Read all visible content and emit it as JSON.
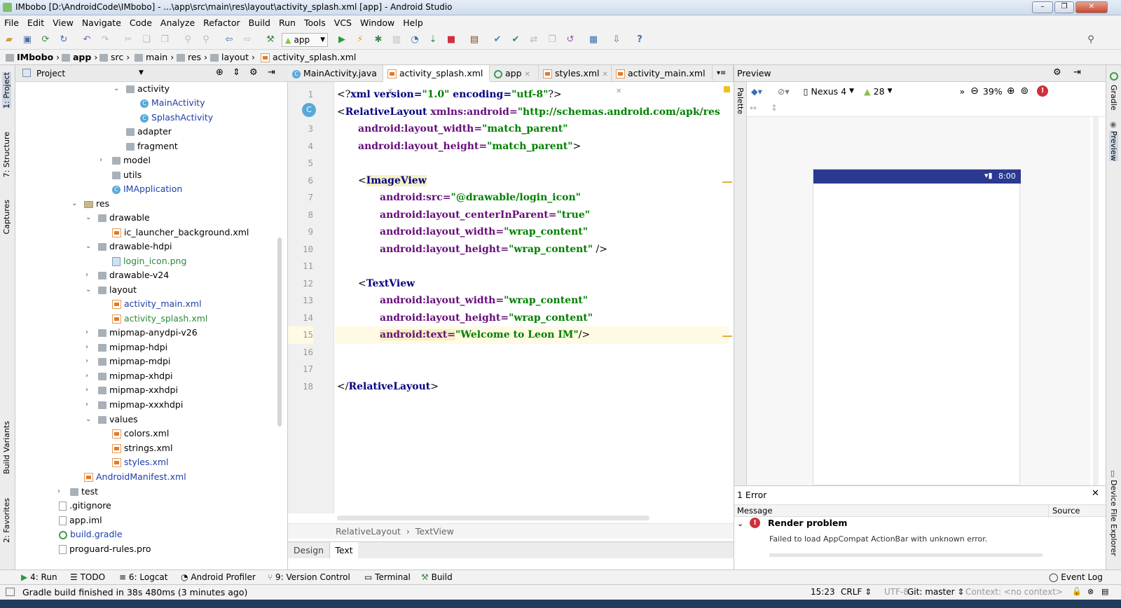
{
  "window": {
    "title": "IMbobo [D:\\AndroidCode\\IMbobo] - ...\\app\\src\\main\\res\\layout\\activity_splash.xml [app] - Android Studio"
  },
  "menu": [
    "File",
    "Edit",
    "View",
    "Navigate",
    "Code",
    "Analyze",
    "Refactor",
    "Build",
    "Run",
    "Tools",
    "VCS",
    "Window",
    "Help"
  ],
  "toolbar": {
    "run_config": "app"
  },
  "breadcrumbs": [
    "IMbobo",
    "app",
    "src",
    "main",
    "res",
    "layout",
    "activity_splash.xml"
  ],
  "left_tabs": {
    "project": "1: Project",
    "structure": "7: Structure",
    "captures": "Captures",
    "build_variants": "Build Variants",
    "favorites": "2: Favorites"
  },
  "project": {
    "title": "Project",
    "items": [
      {
        "label": "activity"
      },
      {
        "label": "MainActivity"
      },
      {
        "label": "SplashActivity"
      },
      {
        "label": "adapter"
      },
      {
        "label": "fragment"
      },
      {
        "label": "model"
      },
      {
        "label": "utils"
      },
      {
        "label": "IMApplication"
      },
      {
        "label": "res"
      },
      {
        "label": "drawable"
      },
      {
        "label": "ic_launcher_background.xml"
      },
      {
        "label": "drawable-hdpi"
      },
      {
        "label": "login_icon.png"
      },
      {
        "label": "drawable-v24"
      },
      {
        "label": "layout"
      },
      {
        "label": "activity_main.xml"
      },
      {
        "label": "activity_splash.xml"
      },
      {
        "label": "mipmap-anydpi-v26"
      },
      {
        "label": "mipmap-hdpi"
      },
      {
        "label": "mipmap-mdpi"
      },
      {
        "label": "mipmap-xhdpi"
      },
      {
        "label": "mipmap-xxhdpi"
      },
      {
        "label": "mipmap-xxxhdpi"
      },
      {
        "label": "values"
      },
      {
        "label": "colors.xml"
      },
      {
        "label": "strings.xml"
      },
      {
        "label": "styles.xml"
      },
      {
        "label": "AndroidManifest.xml"
      },
      {
        "label": "test"
      },
      {
        "label": ".gitignore"
      },
      {
        "label": "app.iml"
      },
      {
        "label": "build.gradle"
      },
      {
        "label": "proguard-rules.pro"
      }
    ]
  },
  "editor_tabs": [
    {
      "label": "MainActivity.java"
    },
    {
      "label": "activity_splash.xml"
    },
    {
      "label": "app"
    },
    {
      "label": "styles.xml"
    },
    {
      "label": "activity_main.xml"
    }
  ],
  "code": {
    "line_numbers": [
      "1",
      "2",
      "3",
      "4",
      "5",
      "6",
      "7",
      "8",
      "9",
      "10",
      "11",
      "12",
      "13",
      "14",
      "15",
      "16",
      "17",
      "18"
    ],
    "l1": {
      "a": "<?",
      "b": "xml version=",
      "c": "\"1.0\"",
      "d": " encoding=",
      "e": "\"utf-8\"",
      "f": "?>"
    },
    "l2": {
      "a": "<",
      "b": "RelativeLayout ",
      "c": "xmlns:android=",
      "d": "\"http://schemas.android.com/apk/res"
    },
    "l3": {
      "a": "android:layout_width=",
      "b": "\"match_parent\""
    },
    "l4": {
      "a": "android:layout_height=",
      "b": "\"match_parent\"",
      "c": ">"
    },
    "l6": {
      "a": "<",
      "b": "ImageView"
    },
    "l7": {
      "a": "android:src=",
      "b": "\"@drawable/login_icon\""
    },
    "l8": {
      "a": "android:layout_centerInParent=",
      "b": "\"true\""
    },
    "l9": {
      "a": "android:layout_width=",
      "b": "\"wrap_content\""
    },
    "l10": {
      "a": "android:layout_height=",
      "b": "\"wrap_content\"",
      "c": " />"
    },
    "l12": {
      "a": "<",
      "b": "TextView"
    },
    "l13": {
      "a": "android:layout_width=",
      "b": "\"wrap_content\""
    },
    "l14": {
      "a": "android:layout_height=",
      "b": "\"wrap_content\""
    },
    "l15": {
      "a": "android:text=",
      "b": "\"Welcome to Leon IM\"",
      "c": "/>"
    },
    "l18": {
      "a": "</",
      "b": "RelativeLayout",
      "c": ">"
    }
  },
  "editor_breadcrumb": [
    "RelativeLayout",
    "TextView"
  ],
  "editor_bottom_tabs": {
    "design": "Design",
    "text": "Text"
  },
  "preview": {
    "title": "Preview",
    "palette": "Palette",
    "device": "Nexus 4",
    "api": "28",
    "zoom": "39%",
    "clock": "8:00",
    "gradle_tab": "Gradle",
    "preview_tab": "Preview",
    "device_explorer_tab": "Device File Explorer"
  },
  "errors": {
    "count": "1 Error",
    "col_message": "Message",
    "col_source": "Source",
    "title": "Render problem",
    "detail": "Failed to load AppCompat ActionBar with unknown error."
  },
  "toolwindows": [
    "4: Run",
    "TODO",
    "6: Logcat",
    "Android Profiler",
    "9: Version Control",
    "Terminal",
    "Build",
    "Event Log"
  ],
  "status": {
    "message": "Gradle build finished in 38s 480ms (3 minutes ago)",
    "position": "15:23",
    "line_sep": "CRLF",
    "encoding": "UTF-8",
    "git": "Git: master",
    "context": "Context: <no context>"
  },
  "colors": {
    "tag": "#000080",
    "attr": "#660e7a",
    "value": "#008000",
    "actionbar": "#2b3990",
    "error": "#d0303a"
  }
}
